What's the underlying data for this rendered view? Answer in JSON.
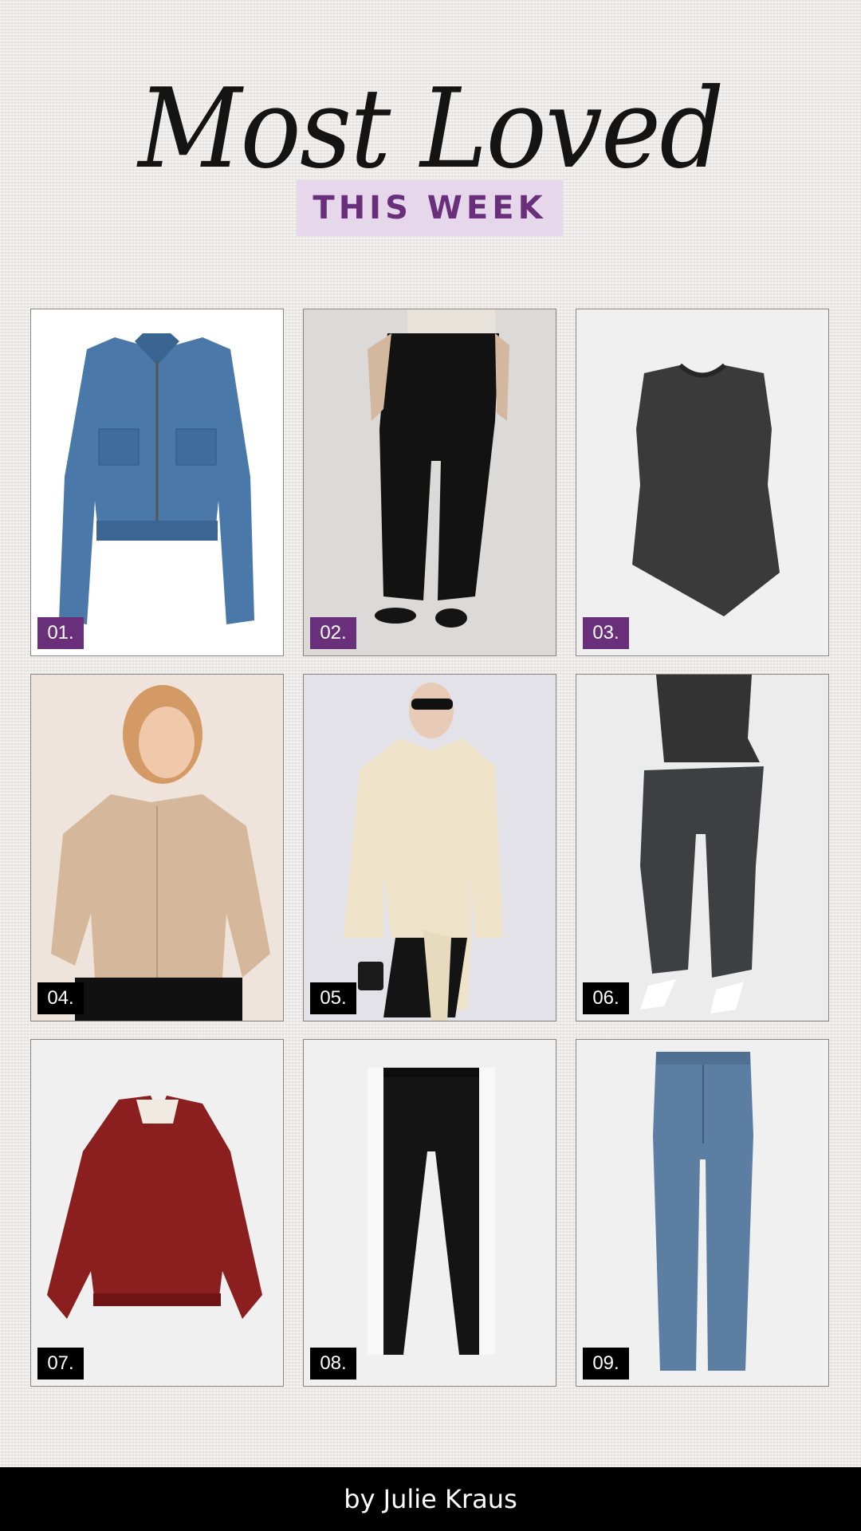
{
  "header": {
    "title": "Most Loved",
    "subtitle": "THIS WEEK"
  },
  "colors": {
    "accent": "#6a2f7a",
    "badge_purple": "#6a2f7a",
    "badge_black": "#000000"
  },
  "items": [
    {
      "number": "01.",
      "item": "denim-zip-jacket"
    },
    {
      "number": "02.",
      "item": "black-barrel-trousers"
    },
    {
      "number": "03.",
      "item": "charcoal-asymmetric-top"
    },
    {
      "number": "04.",
      "item": "tan-utility-jacket"
    },
    {
      "number": "05.",
      "item": "cream-wrap-blazer"
    },
    {
      "number": "06.",
      "item": "charcoal-knit-set"
    },
    {
      "number": "07.",
      "item": "red-satin-bomber"
    },
    {
      "number": "08.",
      "item": "black-side-stripe-joggers"
    },
    {
      "number": "09.",
      "item": "straight-leg-jeans"
    }
  ],
  "footer": {
    "byline": "by Julie Kraus"
  }
}
